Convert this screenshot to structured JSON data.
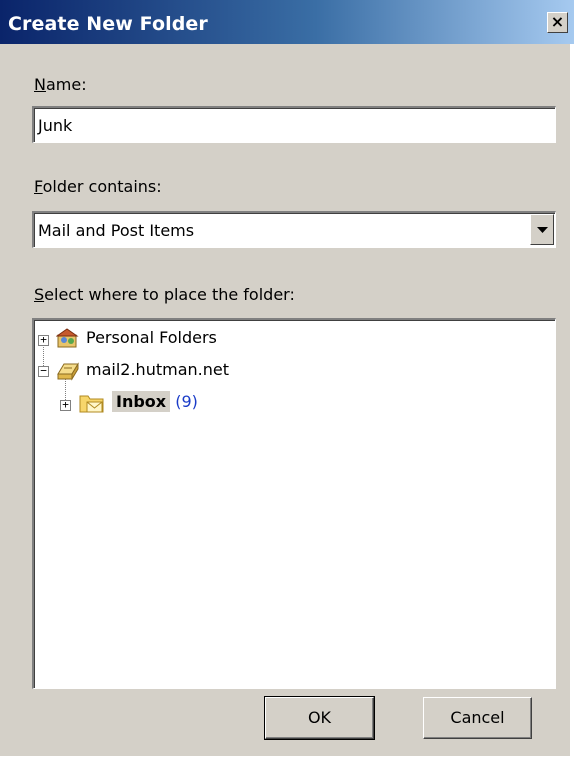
{
  "dialog": {
    "title": "Create New Folder",
    "close_glyph": "×"
  },
  "name": {
    "label_first": "N",
    "label_rest": "ame:",
    "value": "Junk"
  },
  "folder_contains": {
    "label_first": "F",
    "label_rest": "older contains:",
    "value": "Mail and Post Items"
  },
  "placement": {
    "label_first": "S",
    "label_rest": "elect where to place the folder:",
    "tree": [
      {
        "label": "Personal Folders",
        "icon": "personal-folders-icon",
        "expander": "+"
      },
      {
        "label": "mail2.hutman.net",
        "icon": "mailbox-icon",
        "expander": "−"
      },
      {
        "label": "Inbox",
        "count": "(9)",
        "icon": "inbox-folder-icon",
        "expander": "+"
      }
    ]
  },
  "buttons": {
    "ok": "OK",
    "cancel": "Cancel"
  },
  "colors": {
    "title_start": "#0a246a",
    "title_end": "#a6caf0",
    "dialog_bg": "#d4d0c8",
    "count": "#1a3cc8"
  }
}
